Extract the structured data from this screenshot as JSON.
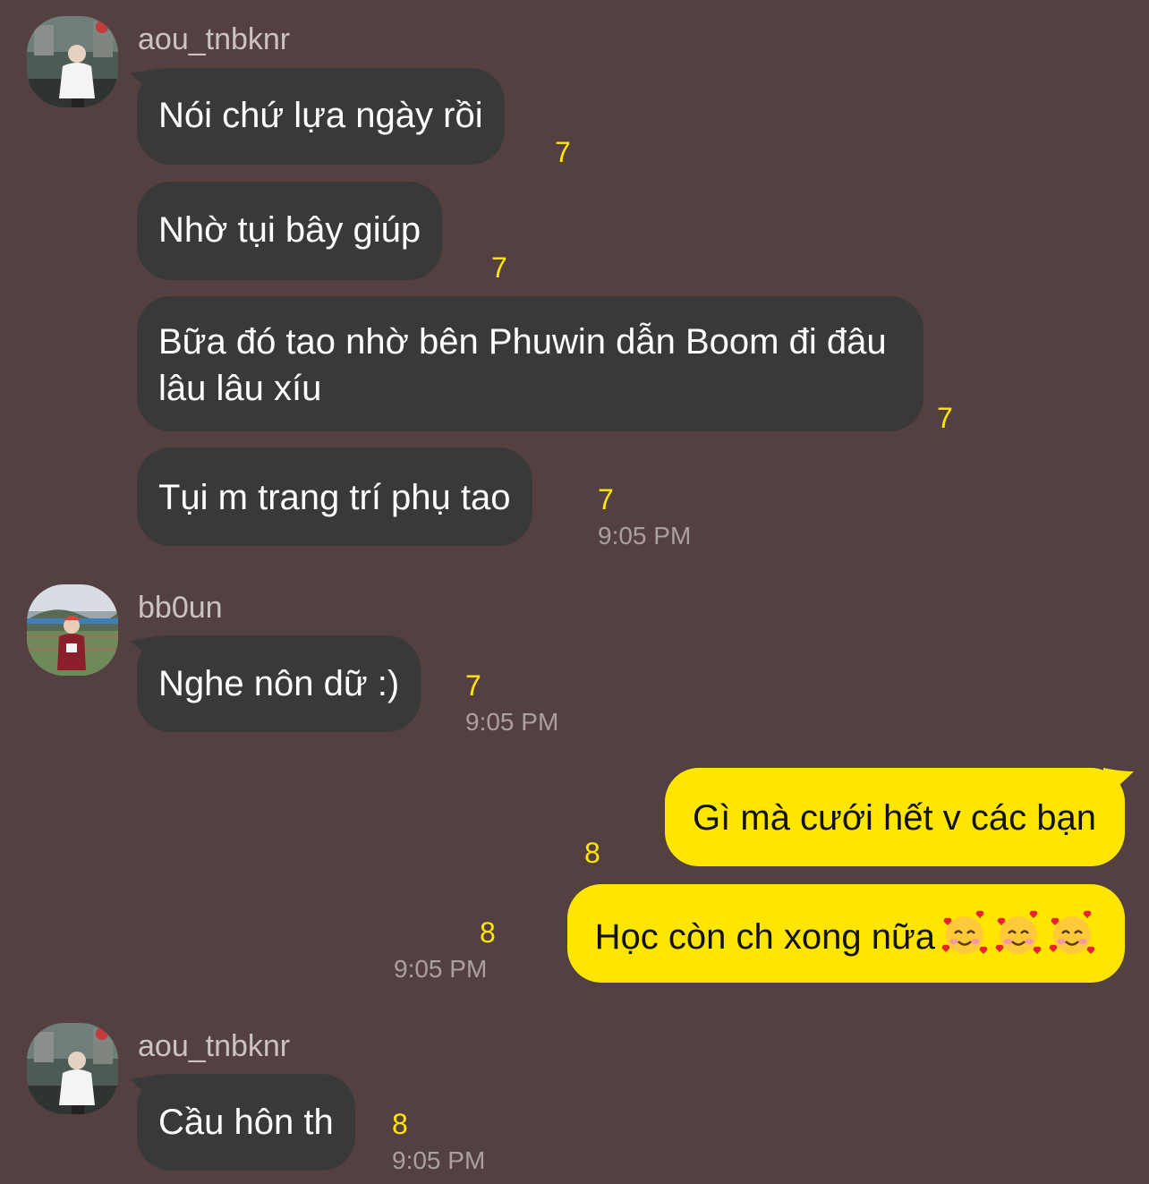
{
  "messages": [
    {
      "sender": "aou_tnbknr",
      "text": "Nói chứ lựa ngày rồi",
      "unread": "7"
    },
    {
      "text": "Nhờ tụi bây giúp",
      "unread": "7"
    },
    {
      "text": "Bữa đó tao nhờ bên Phuwin dẫn Boom đi đâu lâu lâu xíu",
      "unread": "7"
    },
    {
      "text": "Tụi m trang trí phụ tao",
      "unread": "7",
      "time": "9:05 PM"
    },
    {
      "sender": "bb0un",
      "text": "Nghe nôn dữ :)",
      "unread": "7",
      "time": "9:05 PM"
    },
    {
      "text": "Gì mà cưới hết v các bạn",
      "unread": "8"
    },
    {
      "text": "Học còn ch xong nữa",
      "emojis": [
        "smiling-face-with-hearts-emoji",
        "smiling-face-with-hearts-emoji",
        "smiling-face-with-hearts-emoji"
      ],
      "unread": "8",
      "time": "9:05 PM"
    },
    {
      "sender": "aou_tnbknr",
      "text": "Cầu hôn th",
      "unread": "8",
      "time": "9:05 PM"
    }
  ],
  "colors": {
    "background": "#544040",
    "incoming_bubble": "#393939",
    "outgoing_bubble": "#ffe600",
    "unread_count": "#ffe600",
    "timestamp": "#aaa0a0"
  }
}
